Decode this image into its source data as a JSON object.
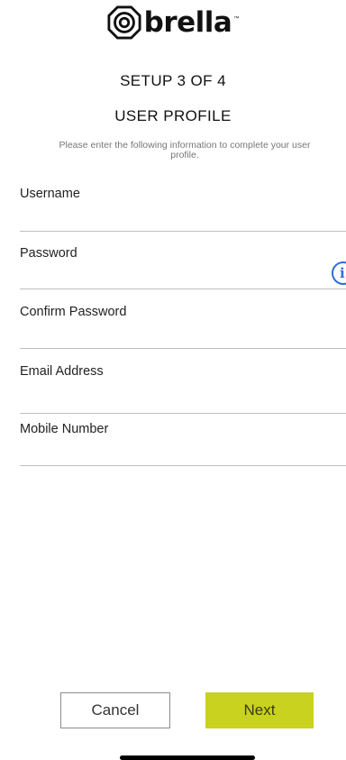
{
  "brand": {
    "name": "brella",
    "trademark": "™"
  },
  "header": {
    "step": "SETUP 3 OF 4",
    "section": "USER PROFILE",
    "instructions": "Please enter the following information to complete your user profile."
  },
  "form": {
    "fields": [
      {
        "label": "Username",
        "value": ""
      },
      {
        "label": "Password",
        "value": ""
      },
      {
        "label": "Confirm Password",
        "value": ""
      },
      {
        "label": "Email Address",
        "value": ""
      },
      {
        "label": "Mobile Number",
        "value": ""
      }
    ],
    "info_icon": "i"
  },
  "actions": {
    "cancel_label": "Cancel",
    "next_label": "Next"
  },
  "colors": {
    "accent": "#c8d21f",
    "info": "#2c6fd6"
  }
}
